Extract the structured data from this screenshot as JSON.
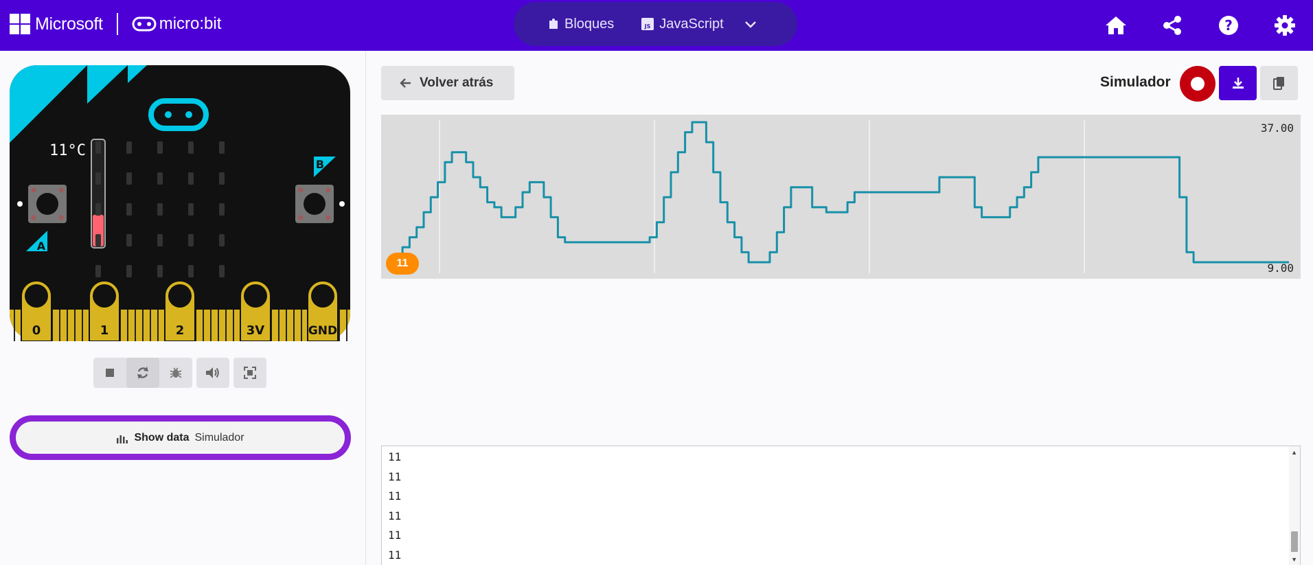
{
  "header": {
    "brand": "Microsoft",
    "product": "micro:bit",
    "tabs": [
      {
        "label": "Bloques",
        "icon": "puzzle-icon"
      },
      {
        "label": "JavaScript",
        "icon": "js-icon"
      }
    ],
    "more_icon": "chevron-down-icon",
    "actions": [
      "home-icon",
      "share-icon",
      "help-icon",
      "gear-icon"
    ],
    "colors": {
      "bar": "#4c00d6",
      "switch": "#3a1aa3"
    }
  },
  "simulator": {
    "temperature": "11°C",
    "temperature_level": 0.3,
    "button_a": "A",
    "button_b": "B",
    "pins": [
      "0",
      "1",
      "2",
      "3V",
      "GND"
    ],
    "controls": [
      "stop-icon",
      "restart-icon",
      "debug-icon",
      "mute-icon",
      "fullscreen-icon"
    ],
    "show_data": {
      "bold": "Show data",
      "label": "Simulador"
    }
  },
  "data_view": {
    "back_label": "Volver atrás",
    "title": "Simulador",
    "badge": "11",
    "console_lines": [
      "11",
      "11",
      "11",
      "11",
      "11",
      "11"
    ]
  },
  "chart_data": {
    "type": "line",
    "ymax_label": "37.00",
    "ymin_label": "9.00",
    "ylim": [
      9,
      37
    ],
    "grid": "vertical",
    "series": [
      {
        "color": "#1790a8",
        "values": [
          9,
          12,
          14,
          16,
          19,
          22,
          25,
          29,
          31,
          31,
          29,
          26,
          24,
          21,
          20,
          18,
          18,
          20,
          23,
          25,
          25,
          22,
          18,
          14,
          13,
          13,
          13,
          13,
          13,
          13,
          13,
          13,
          13,
          13,
          13,
          13,
          14,
          17,
          22,
          27,
          31,
          35,
          37,
          37,
          33,
          27,
          21,
          17,
          14,
          11,
          9,
          9,
          9,
          11,
          15,
          20,
          24,
          24,
          24,
          20,
          20,
          19,
          19,
          19,
          21,
          23,
          23,
          23,
          23,
          23,
          23,
          23,
          23,
          23,
          23,
          23,
          23,
          26,
          26,
          26,
          26,
          26,
          20,
          18,
          18,
          18,
          18,
          20,
          22,
          24,
          27,
          30,
          30,
          30,
          30,
          30,
          30,
          30,
          30,
          30,
          30,
          30,
          30,
          30,
          30,
          30,
          30,
          30,
          30,
          30,
          30,
          22,
          11,
          9,
          9,
          9,
          9,
          9,
          9,
          9,
          9,
          9,
          9,
          9,
          9,
          9,
          9
        ]
      }
    ]
  }
}
